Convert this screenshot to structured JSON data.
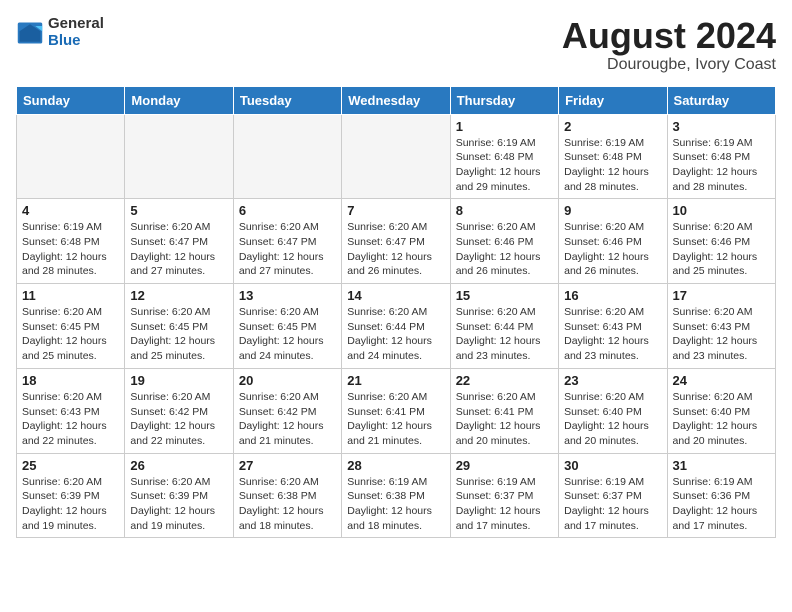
{
  "logo": {
    "general": "General",
    "blue": "Blue"
  },
  "title": "August 2024",
  "subtitle": "Dourougbe, Ivory Coast",
  "days_of_week": [
    "Sunday",
    "Monday",
    "Tuesday",
    "Wednesday",
    "Thursday",
    "Friday",
    "Saturday"
  ],
  "weeks": [
    [
      {
        "day": "",
        "info": ""
      },
      {
        "day": "",
        "info": ""
      },
      {
        "day": "",
        "info": ""
      },
      {
        "day": "",
        "info": ""
      },
      {
        "day": "1",
        "info": "Sunrise: 6:19 AM\nSunset: 6:48 PM\nDaylight: 12 hours and 29 minutes."
      },
      {
        "day": "2",
        "info": "Sunrise: 6:19 AM\nSunset: 6:48 PM\nDaylight: 12 hours and 28 minutes."
      },
      {
        "day": "3",
        "info": "Sunrise: 6:19 AM\nSunset: 6:48 PM\nDaylight: 12 hours and 28 minutes."
      }
    ],
    [
      {
        "day": "4",
        "info": "Sunrise: 6:19 AM\nSunset: 6:48 PM\nDaylight: 12 hours and 28 minutes."
      },
      {
        "day": "5",
        "info": "Sunrise: 6:20 AM\nSunset: 6:47 PM\nDaylight: 12 hours and 27 minutes."
      },
      {
        "day": "6",
        "info": "Sunrise: 6:20 AM\nSunset: 6:47 PM\nDaylight: 12 hours and 27 minutes."
      },
      {
        "day": "7",
        "info": "Sunrise: 6:20 AM\nSunset: 6:47 PM\nDaylight: 12 hours and 26 minutes."
      },
      {
        "day": "8",
        "info": "Sunrise: 6:20 AM\nSunset: 6:46 PM\nDaylight: 12 hours and 26 minutes."
      },
      {
        "day": "9",
        "info": "Sunrise: 6:20 AM\nSunset: 6:46 PM\nDaylight: 12 hours and 26 minutes."
      },
      {
        "day": "10",
        "info": "Sunrise: 6:20 AM\nSunset: 6:46 PM\nDaylight: 12 hours and 25 minutes."
      }
    ],
    [
      {
        "day": "11",
        "info": "Sunrise: 6:20 AM\nSunset: 6:45 PM\nDaylight: 12 hours and 25 minutes."
      },
      {
        "day": "12",
        "info": "Sunrise: 6:20 AM\nSunset: 6:45 PM\nDaylight: 12 hours and 25 minutes."
      },
      {
        "day": "13",
        "info": "Sunrise: 6:20 AM\nSunset: 6:45 PM\nDaylight: 12 hours and 24 minutes."
      },
      {
        "day": "14",
        "info": "Sunrise: 6:20 AM\nSunset: 6:44 PM\nDaylight: 12 hours and 24 minutes."
      },
      {
        "day": "15",
        "info": "Sunrise: 6:20 AM\nSunset: 6:44 PM\nDaylight: 12 hours and 23 minutes."
      },
      {
        "day": "16",
        "info": "Sunrise: 6:20 AM\nSunset: 6:43 PM\nDaylight: 12 hours and 23 minutes."
      },
      {
        "day": "17",
        "info": "Sunrise: 6:20 AM\nSunset: 6:43 PM\nDaylight: 12 hours and 23 minutes."
      }
    ],
    [
      {
        "day": "18",
        "info": "Sunrise: 6:20 AM\nSunset: 6:43 PM\nDaylight: 12 hours and 22 minutes."
      },
      {
        "day": "19",
        "info": "Sunrise: 6:20 AM\nSunset: 6:42 PM\nDaylight: 12 hours and 22 minutes."
      },
      {
        "day": "20",
        "info": "Sunrise: 6:20 AM\nSunset: 6:42 PM\nDaylight: 12 hours and 21 minutes."
      },
      {
        "day": "21",
        "info": "Sunrise: 6:20 AM\nSunset: 6:41 PM\nDaylight: 12 hours and 21 minutes."
      },
      {
        "day": "22",
        "info": "Sunrise: 6:20 AM\nSunset: 6:41 PM\nDaylight: 12 hours and 20 minutes."
      },
      {
        "day": "23",
        "info": "Sunrise: 6:20 AM\nSunset: 6:40 PM\nDaylight: 12 hours and 20 minutes."
      },
      {
        "day": "24",
        "info": "Sunrise: 6:20 AM\nSunset: 6:40 PM\nDaylight: 12 hours and 20 minutes."
      }
    ],
    [
      {
        "day": "25",
        "info": "Sunrise: 6:20 AM\nSunset: 6:39 PM\nDaylight: 12 hours and 19 minutes."
      },
      {
        "day": "26",
        "info": "Sunrise: 6:20 AM\nSunset: 6:39 PM\nDaylight: 12 hours and 19 minutes."
      },
      {
        "day": "27",
        "info": "Sunrise: 6:20 AM\nSunset: 6:38 PM\nDaylight: 12 hours and 18 minutes."
      },
      {
        "day": "28",
        "info": "Sunrise: 6:19 AM\nSunset: 6:38 PM\nDaylight: 12 hours and 18 minutes."
      },
      {
        "day": "29",
        "info": "Sunrise: 6:19 AM\nSunset: 6:37 PM\nDaylight: 12 hours and 17 minutes."
      },
      {
        "day": "30",
        "info": "Sunrise: 6:19 AM\nSunset: 6:37 PM\nDaylight: 12 hours and 17 minutes."
      },
      {
        "day": "31",
        "info": "Sunrise: 6:19 AM\nSunset: 6:36 PM\nDaylight: 12 hours and 17 minutes."
      }
    ]
  ]
}
